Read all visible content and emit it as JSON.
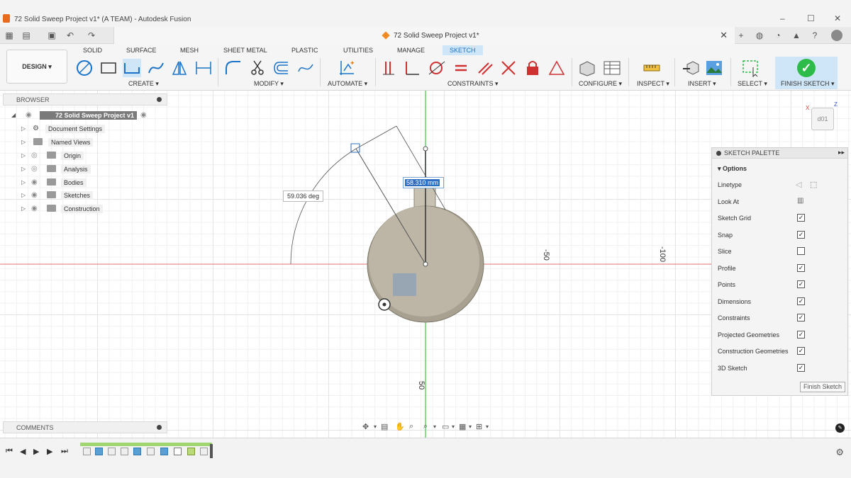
{
  "window": {
    "title": "72 Solid Sweep Project v1* (A TEAM) - Autodesk Fusion",
    "minimize": "–",
    "maximize": "☐",
    "close": "✕"
  },
  "document_tab": {
    "title": "72 Solid Sweep Project v1*"
  },
  "ribbon": {
    "design_label": "DESIGN ▾",
    "tabs": [
      "SOLID",
      "SURFACE",
      "MESH",
      "SHEET METAL",
      "PLASTIC",
      "UTILITIES",
      "MANAGE",
      "SKETCH"
    ],
    "active_tab": "SKETCH",
    "groups": {
      "create": "CREATE ▾",
      "modify": "MODIFY ▾",
      "automate": "AUTOMATE ▾",
      "constraints": "CONSTRAINTS ▾",
      "configure": "CONFIGURE ▾",
      "inspect": "INSPECT ▾",
      "insert": "INSERT ▾",
      "select": "SELECT ▾",
      "finish": "FINISH SKETCH ▾"
    }
  },
  "browser": {
    "header": "BROWSER",
    "root": "72 Solid Sweep Project v1",
    "items": [
      "Document Settings",
      "Named Views",
      "Origin",
      "Analysis",
      "Bodies",
      "Sketches",
      "Construction"
    ]
  },
  "comments": {
    "header": "COMMENTS"
  },
  "canvas": {
    "angle_dimension": "59.036 deg",
    "length_dimension": "58.310 mm",
    "axis_ticks": [
      "-50",
      "-100",
      "50"
    ],
    "viewcube_label": "d01",
    "viewcube_axis_x": "X",
    "viewcube_axis_z": "Z"
  },
  "sketch_palette": {
    "header": "SKETCH PALETTE",
    "options_header": "Options",
    "rows": [
      {
        "label": "Linetype",
        "kind": "icons"
      },
      {
        "label": "Look At",
        "kind": "icon"
      },
      {
        "label": "Sketch Grid",
        "checked": true
      },
      {
        "label": "Snap",
        "checked": true
      },
      {
        "label": "Slice",
        "checked": false
      },
      {
        "label": "Profile",
        "checked": true
      },
      {
        "label": "Points",
        "checked": true
      },
      {
        "label": "Dimensions",
        "checked": true
      },
      {
        "label": "Constraints",
        "checked": true
      },
      {
        "label": "Projected Geometries",
        "checked": true
      },
      {
        "label": "Construction Geometries",
        "checked": true
      },
      {
        "label": "3D Sketch",
        "checked": true
      }
    ],
    "finish_button": "Finish Sketch"
  },
  "colors": {
    "accent": "#1a73c8",
    "finish_green": "#2dbb4a",
    "body_fill": "#bdb6a6",
    "axis_green": "#3cc83c",
    "axis_red": "#e05050"
  }
}
